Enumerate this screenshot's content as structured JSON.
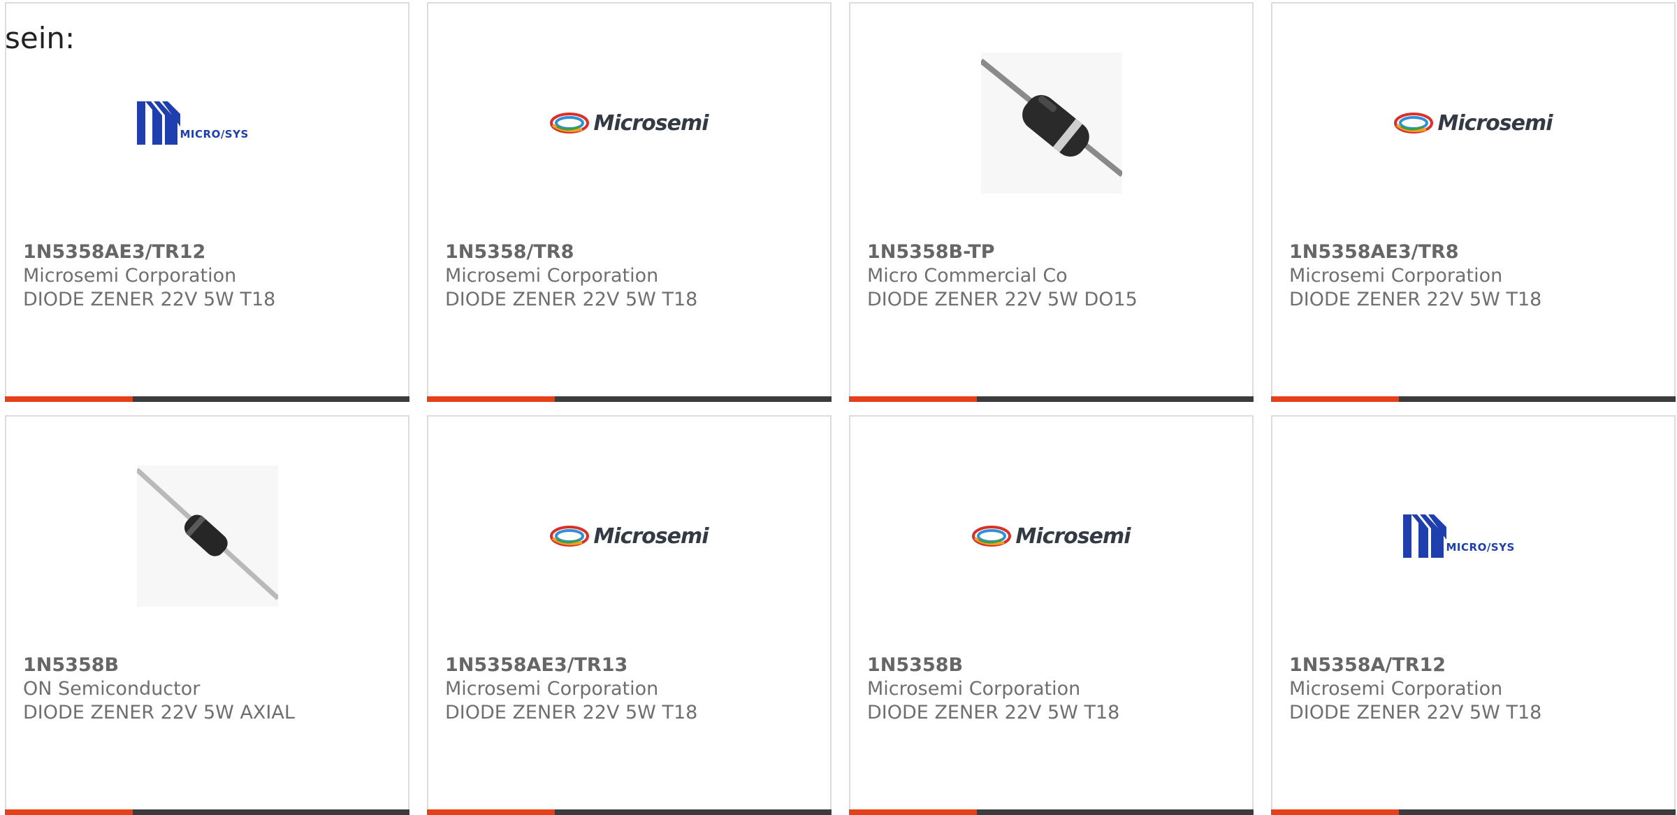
{
  "intro_text": "sein:",
  "products": [
    {
      "part_number": "1N5358AE3/TR12",
      "manufacturer": "Microsemi Corporation",
      "description": "DIODE ZENER 22V 5W T18",
      "image": "microsys-logo",
      "logo_text": "MICRO/SYS"
    },
    {
      "part_number": "1N5358/TR8",
      "manufacturer": "Microsemi Corporation",
      "description": "DIODE ZENER 22V 5W T18",
      "image": "microsemi-logo",
      "logo_text": "Microsemi"
    },
    {
      "part_number": "1N5358B-TP",
      "manufacturer": "Micro Commercial Co",
      "description": "DIODE ZENER 22V 5W DO15",
      "image": "axial-diode-photo-large"
    },
    {
      "part_number": "1N5358AE3/TR8",
      "manufacturer": "Microsemi Corporation",
      "description": "DIODE ZENER 22V 5W T18",
      "image": "microsemi-logo",
      "logo_text": "Microsemi"
    },
    {
      "part_number": "1N5358B",
      "manufacturer": "ON Semiconductor",
      "description": "DIODE ZENER 22V 5W AXIAL",
      "image": "axial-diode-photo-small"
    },
    {
      "part_number": "1N5358AE3/TR13",
      "manufacturer": "Microsemi Corporation",
      "description": "DIODE ZENER 22V 5W T18",
      "image": "microsemi-logo",
      "logo_text": "Microsemi"
    },
    {
      "part_number": "1N5358B",
      "manufacturer": "Microsemi Corporation",
      "description": "DIODE ZENER 22V 5W T18",
      "image": "microsemi-logo",
      "logo_text": "Microsemi"
    },
    {
      "part_number": "1N5358A/TR12",
      "manufacturer": "Microsemi Corporation",
      "description": "DIODE ZENER 22V 5W T18",
      "image": "microsys-logo",
      "logo_text": "MICRO/SYS"
    }
  ],
  "colors": {
    "accent": "#e5401a",
    "bar": "#3c3c3c",
    "border": "#dcdcdc",
    "text": "#6f6f6f",
    "microsys_blue": "#1f3fae"
  }
}
